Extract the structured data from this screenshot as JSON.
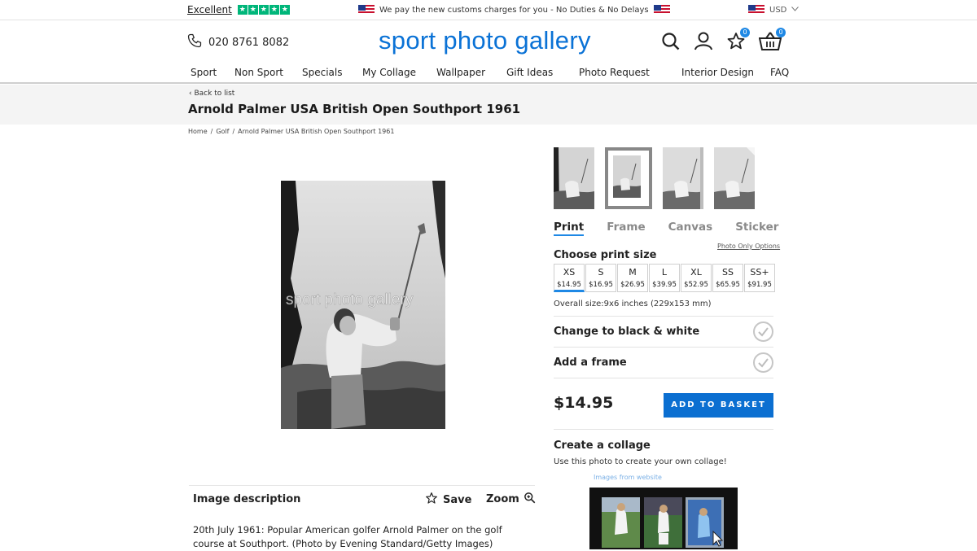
{
  "topbar": {
    "trustpilot_label": "Excellent",
    "promo_text": "We pay the new customs charges for you - No Duties & No Delays",
    "currency": "USD"
  },
  "header": {
    "phone": "020 8761 8082",
    "logo": "sport photo gallery",
    "wishlist_count": "0",
    "basket_count": "0",
    "icons": [
      "phone-icon",
      "search-icon",
      "user-icon",
      "star-icon",
      "basket-icon"
    ]
  },
  "nav": [
    "Sport",
    "Non Sport",
    "Specials",
    "My Collage",
    "Wallpaper",
    "Gift Ideas",
    "Photo Request",
    "Interior Design",
    "FAQ"
  ],
  "page": {
    "back_label": "Back to list",
    "title": "Arnold Palmer USA British Open Southport 1961",
    "breadcrumbs": [
      "Home",
      "Golf",
      "Arnold Palmer USA British Open Southport 1961"
    ],
    "watermark": "sport photo gallery"
  },
  "description": {
    "heading": "Image description",
    "save_label": "Save",
    "zoom_label": "Zoom",
    "text": "20th July 1961: Popular American golfer Arnold Palmer on the golf course at Southport. (Photo by Evening Standard/Getty Images)"
  },
  "product": {
    "tabs": [
      "Print",
      "Frame",
      "Canvas",
      "Sticker"
    ],
    "active_tab": "Print",
    "photo_only_link": "Photo Only Options",
    "choose_size_label": "Choose print size",
    "sizes": [
      {
        "label": "XS",
        "price": "$14.95"
      },
      {
        "label": "S",
        "price": "$16.95"
      },
      {
        "label": "M",
        "price": "$26.95"
      },
      {
        "label": "L",
        "price": "$39.95"
      },
      {
        "label": "XL",
        "price": "$52.95"
      },
      {
        "label": "SS",
        "price": "$65.95"
      },
      {
        "label": "SS+",
        "price": "$91.95"
      }
    ],
    "selected_size": "XS",
    "overall_size": "Overall size:9x6 inches (229x153 mm)",
    "bw_label": "Change to black & white",
    "frame_label": "Add a frame",
    "price": "$14.95",
    "add_to_basket": "ADD TO BASKET",
    "collage_title": "Create a collage",
    "collage_sub": "Use this photo to create your own collage!",
    "collage_preview_heading": "Images from website"
  },
  "colors": {
    "brand_blue": "#0a72d6",
    "button_blue": "#0b6fd1",
    "trustpilot_green": "#00b67a"
  }
}
